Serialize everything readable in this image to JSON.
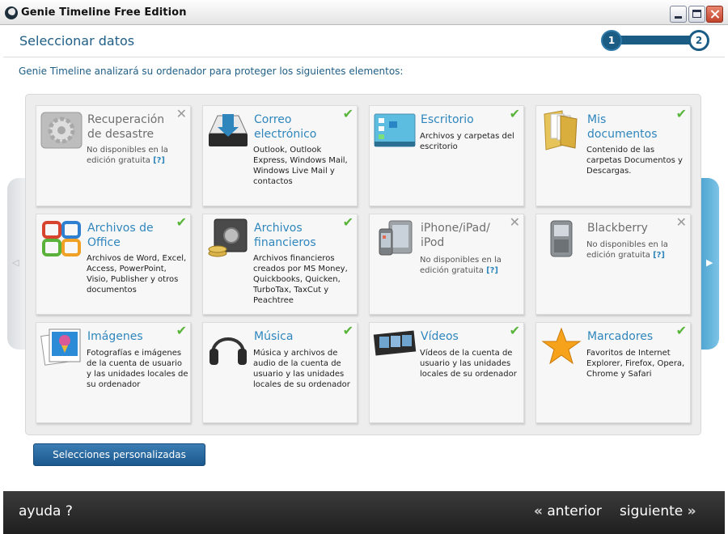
{
  "window": {
    "title": "Genie Timeline Free Edition"
  },
  "header": {
    "title": "Seleccionar datos",
    "steps": [
      "1",
      "2"
    ]
  },
  "intro": "Genie Timeline analizará su ordenador para proteger los siguientes elementos:",
  "nav": {
    "left": "◁",
    "right": "▶"
  },
  "cards": [
    {
      "title": "Recuperación de desastre",
      "desc": "No disponibles en la edición gratuita",
      "help": "[?]",
      "status": "✕",
      "icon": "gear-icon"
    },
    {
      "title": "Correo electrónico",
      "desc": "Outlook, Outlook Express, Windows Mail, Windows Live Mail y contactos",
      "status": "✔",
      "icon": "mail-inbox-icon"
    },
    {
      "title": "Escritorio",
      "desc": "Archivos y carpetas del escritorio",
      "status": "✔",
      "icon": "desktop-icon"
    },
    {
      "title": "Mis documentos",
      "desc": "Contenido de las carpetas Documentos y Descargas.",
      "status": "✔",
      "icon": "documents-folder-icon"
    },
    {
      "title": "Archivos de Office",
      "desc": "Archivos de Word, Excel, Access, PowerPoint, Visio, Publisher y otros documentos",
      "status": "✔",
      "icon": "office-icon"
    },
    {
      "title": "Archivos financieros",
      "desc": "Archivos financieros creados por MS Money, Quickbooks, Quicken, TurboTax, TaxCut y Peachtree",
      "status": "✔",
      "icon": "safe-coins-icon"
    },
    {
      "title": "iPhone/iPad/ iPod",
      "desc": "No disponibles en la edición gratuita",
      "help": "[?]",
      "status": "✕",
      "icon": "mobile-devices-icon"
    },
    {
      "title": "Blackberry",
      "desc": "No disponibles en la edición gratuita",
      "help": "[?]",
      "status": "✕",
      "icon": "blackberry-icon"
    },
    {
      "title": "Imágenes",
      "desc": "Fotografías e imágenes de la cuenta de usuario y las unidades locales de su ordenador",
      "status": "✔",
      "icon": "pictures-icon"
    },
    {
      "title": "Música",
      "desc": "Música y archivos de audio de la cuenta de usuario y las unidades locales de su ordenador",
      "status": "✔",
      "icon": "headphones-icon"
    },
    {
      "title": "Vídeos",
      "desc": "Vídeos de la cuenta de usuario y las unidades locales de su ordenador",
      "status": "✔",
      "icon": "film-icon"
    },
    {
      "title": "Marcadores",
      "desc": "Favoritos de Internet Explorer, Firefox, Opera, Chrome y Safari",
      "status": "✔",
      "icon": "star-icon"
    }
  ],
  "custom_button": "Selecciones personalizadas",
  "footer": {
    "help": "ayuda ?",
    "prev_chev": "«",
    "prev": "anterior",
    "next": "siguiente",
    "next_chev": "»"
  },
  "colors": {
    "accent": "#2f86bd",
    "check": "#59b53a",
    "dark_blue": "#1b5c85"
  }
}
